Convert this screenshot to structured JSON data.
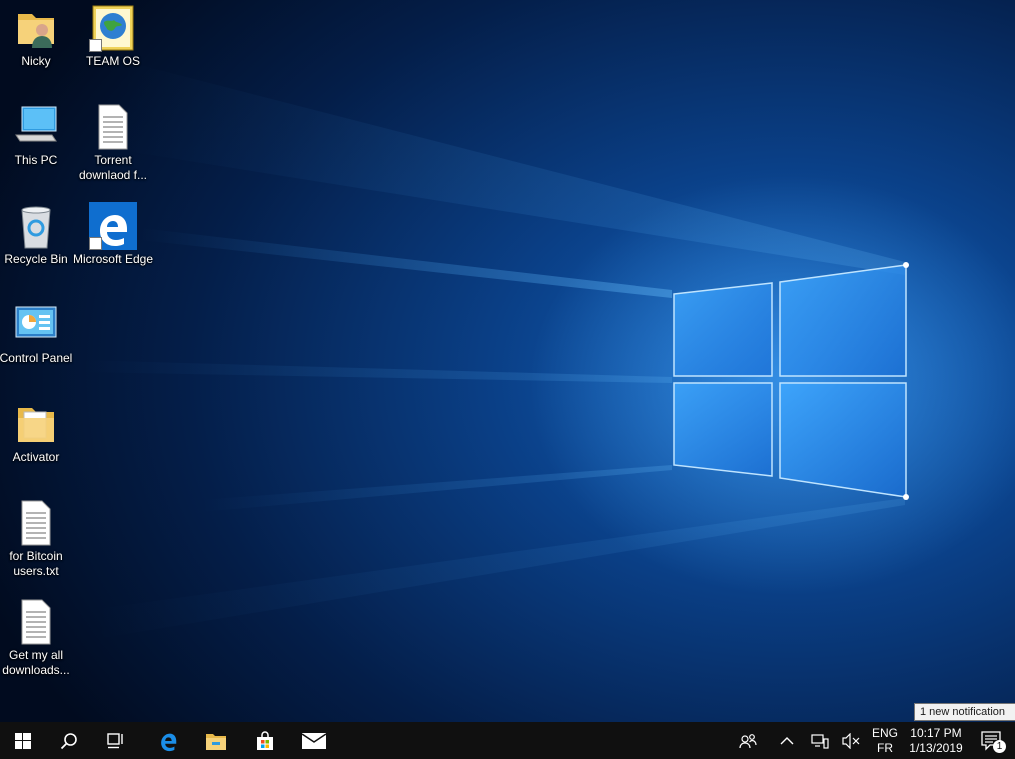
{
  "desktop": {
    "icons": [
      {
        "name": "Nicky",
        "icon": "user-folder-icon"
      },
      {
        "name": "TEAM OS",
        "icon": "globe-shortcut-icon"
      },
      {
        "name": "This PC",
        "icon": "computer-icon"
      },
      {
        "name": "Torrent downlaod f...",
        "icon": "text-file-icon"
      },
      {
        "name": "Recycle Bin",
        "icon": "recycle-bin-icon"
      },
      {
        "name": "Microsoft Edge",
        "icon": "edge-icon"
      },
      {
        "name": "Control Panel",
        "icon": "control-panel-icon"
      },
      {
        "name": "Activator",
        "icon": "folder-icon"
      },
      {
        "name": "for Bitcoin users.txt",
        "icon": "text-file-icon"
      },
      {
        "name": "Get my all downloads...",
        "icon": "text-file-icon"
      }
    ]
  },
  "taskbar": {
    "pinned": [
      "start-icon",
      "search-icon",
      "task-view-icon",
      "edge-icon",
      "file-explorer-icon",
      "store-icon",
      "mail-icon"
    ],
    "tray": {
      "language_top": "ENG",
      "language_bottom": "FR",
      "time": "10:17 PM",
      "date": "1/13/2019",
      "notification_count": "1"
    }
  },
  "toast": {
    "text": "1 new notification"
  },
  "colors": {
    "taskbar": "#101010",
    "accent": "#0078d7",
    "wallpaper_glow": "#3ea6ff"
  }
}
